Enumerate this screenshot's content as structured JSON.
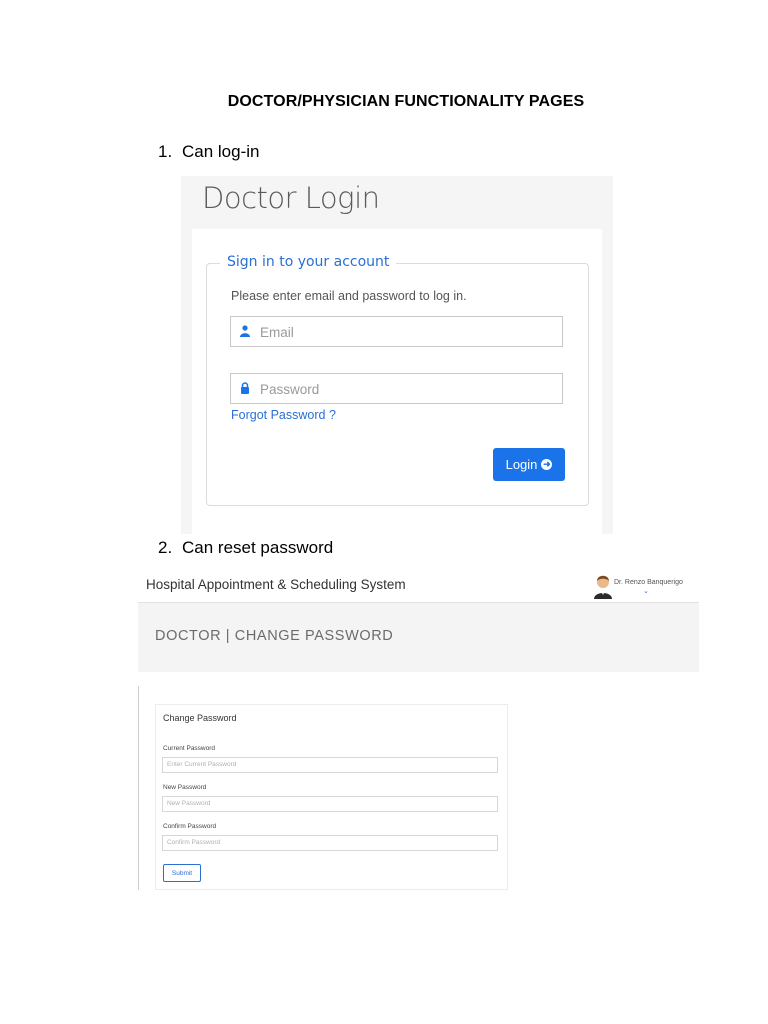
{
  "document": {
    "title": "DOCTOR/PHYSICIAN FUNCTIONALITY PAGES",
    "items": [
      {
        "num": "1.",
        "text": "Can log-in"
      },
      {
        "num": "2.",
        "text": "Can reset password"
      }
    ]
  },
  "login": {
    "heading": "Doctor Login",
    "legend": "Sign in to your account",
    "instruction": "Please enter email and password to log in.",
    "email_placeholder": "Email",
    "password_placeholder": "Password",
    "forgot": "Forgot Password ?",
    "button": "Login",
    "button_icon": "arrow-circle-right-icon",
    "accent": "#1a73e8"
  },
  "change_password": {
    "app_title": "Hospital Appointment & Scheduling System",
    "user_name": "Dr. Renzo Banquerigo",
    "page_title": "DOCTOR | CHANGE PASSWORD",
    "card_title": "Change Password",
    "fields": [
      {
        "label": "Current Password",
        "placeholder": "Enter Current Password"
      },
      {
        "label": "New Password",
        "placeholder": "New Password"
      },
      {
        "label": "Confirm Password",
        "placeholder": "Confirm Password"
      }
    ],
    "submit": "Submit"
  }
}
